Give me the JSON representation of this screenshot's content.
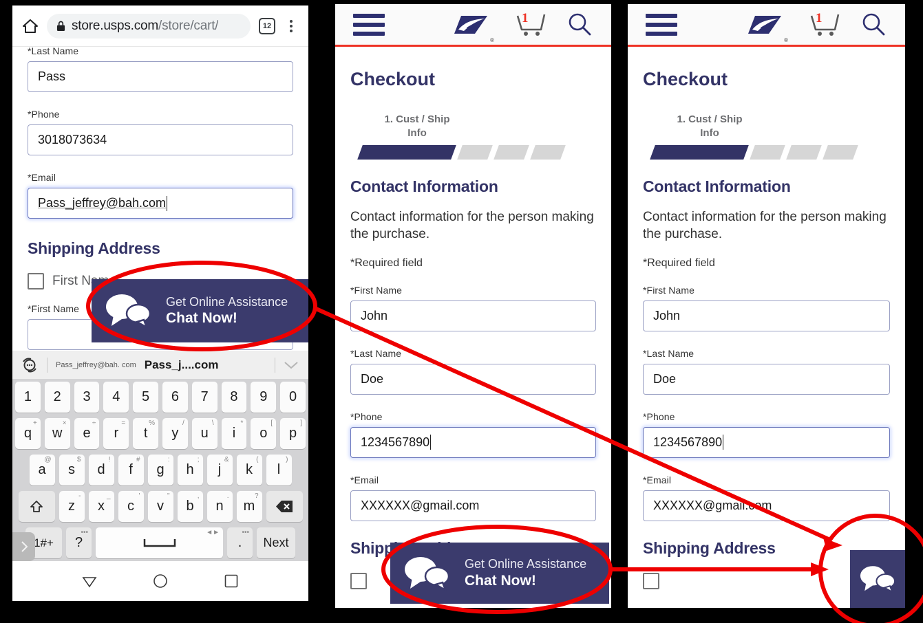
{
  "browser": {
    "url_bold": "store.usps.com",
    "url_dim": "/store/cart/",
    "tab_count": "12",
    "home_icon": "home-icon",
    "lock_icon": "lock-icon",
    "menu_icon": "kebab-menu-icon"
  },
  "left_panel": {
    "fields": [
      {
        "label": "*Last Name",
        "value": "Pass"
      },
      {
        "label": "*Phone",
        "value": "3018073634"
      },
      {
        "label": "*Email",
        "value": "Pass_jeffrey@bah.com"
      }
    ],
    "shipping_title": "Shipping Address",
    "same_as_checkbox_label": "First Name",
    "ship_first_name_label": "*First Name"
  },
  "keyboard": {
    "suggestion_left": "Pass_jeffrey@bah. com",
    "suggestion_right": "Pass_j....com",
    "sync_icon": "keyboard-sync-icon",
    "expand_icon": "chevron-down-icon",
    "row_numbers": [
      "1",
      "2",
      "3",
      "4",
      "5",
      "6",
      "7",
      "8",
      "9",
      "0"
    ],
    "row_top": [
      {
        "k": "q",
        "alt": "+"
      },
      {
        "k": "w",
        "alt": "×"
      },
      {
        "k": "e",
        "alt": "÷"
      },
      {
        "k": "r",
        "alt": "="
      },
      {
        "k": "t",
        "alt": "%"
      },
      {
        "k": "y",
        "alt": "/"
      },
      {
        "k": "u",
        "alt": "\\"
      },
      {
        "k": "i",
        "alt": "*"
      },
      {
        "k": "o",
        "alt": "["
      },
      {
        "k": "p",
        "alt": "]"
      }
    ],
    "row_home": [
      {
        "k": "a",
        "alt": "@"
      },
      {
        "k": "s",
        "alt": "$"
      },
      {
        "k": "d",
        "alt": "!"
      },
      {
        "k": "f",
        "alt": "#"
      },
      {
        "k": "g",
        "alt": ":"
      },
      {
        "k": "h",
        "alt": ";"
      },
      {
        "k": "j",
        "alt": "&"
      },
      {
        "k": "k",
        "alt": "("
      },
      {
        "k": "l",
        "alt": ")"
      }
    ],
    "row_bottom": [
      {
        "k": "z",
        "alt": "-"
      },
      {
        "k": "x",
        "alt": "_"
      },
      {
        "k": "c",
        "alt": "'"
      },
      {
        "k": "v",
        "alt": "\""
      },
      {
        "k": "b",
        "alt": ","
      },
      {
        "k": "n",
        "alt": "."
      },
      {
        "k": "m",
        "alt": "?"
      }
    ],
    "shift_icon": "shift-key-icon",
    "backspace_icon": "backspace-key-icon",
    "symbols_key": "1#+",
    "question_key": "?",
    "space_icon": "space-key-icon",
    "period_key": ".",
    "next_key": "Next",
    "drawer_tab_icon": "chevron-right-icon"
  },
  "android_nav": {
    "back_icon": "nav-back-triangle-icon",
    "home_icon": "nav-home-circle-icon",
    "recents_icon": "nav-recents-square-icon"
  },
  "usps_header": {
    "menu_icon": "hamburger-menu-icon",
    "logo_icon": "usps-eagle-logo-icon",
    "logo_registered": "®",
    "cart_icon": "shopping-cart-icon",
    "cart_count": "1",
    "search_icon": "search-icon"
  },
  "checkout": {
    "title": "Checkout",
    "step_label": "1. Cust / Ship\nInfo",
    "step_label_line1": "1. Cust / Ship",
    "step_label_line2": "Info",
    "steps_total": 4,
    "steps_active": 1,
    "contact_title": "Contact Information",
    "contact_desc": "Contact information for the person making the purchase.",
    "required_note": "*Required field",
    "fields": [
      {
        "label": "*First Name",
        "value": "John"
      },
      {
        "label": "*Last Name",
        "value": "Doe"
      },
      {
        "label": "*Phone",
        "value": "1234567890"
      },
      {
        "label": "*Email",
        "value": "XXXXXX@gmail.com"
      }
    ],
    "shipping_title": "Shipping Address"
  },
  "chat_widget": {
    "line1": "Get Online Assistance",
    "line2": "Chat Now!",
    "icon": "chat-bubbles-icon"
  },
  "annotations": {
    "ellipse_color": "#ee0000",
    "arrow_color": "#ee0000",
    "count": 3
  },
  "colors": {
    "usps_blue": "#333366",
    "usps_red": "#ee3124",
    "chat_navy": "#3b3b6d",
    "annotation_red": "#ee0000",
    "input_border": "#9aa0c4"
  }
}
